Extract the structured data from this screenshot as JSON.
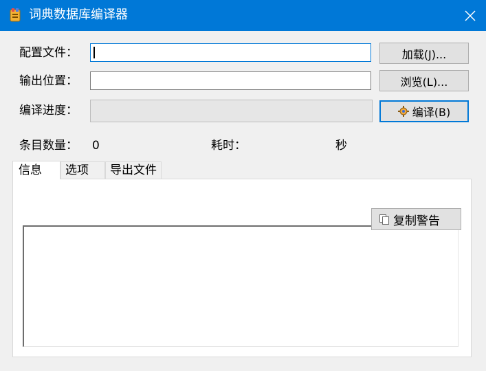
{
  "window": {
    "title": "词典数据库编译器"
  },
  "form": {
    "config_label": "配置文件：",
    "config_value": "",
    "output_label": "输出位置：",
    "output_value": "",
    "progress_label": "编译进度：",
    "progress_value": 0
  },
  "buttons": {
    "load": "加载(J)...",
    "browse": "浏览(L)...",
    "compile": "编译(B)",
    "copy_warnings": "复制警告"
  },
  "stats": {
    "entry_count_label": "条目数量：",
    "entry_count_value": "0",
    "time_label": "耗时：",
    "time_unit": "秒"
  },
  "tabs": [
    {
      "label": "信息",
      "active": true
    },
    {
      "label": "选项",
      "active": false
    },
    {
      "label": "导出文件",
      "active": false
    }
  ],
  "colors": {
    "titlebar": "#0078d7",
    "accent": "#0078d7"
  },
  "icons": {
    "app": "app-icon",
    "close": "close-icon",
    "compile": "compile-icon",
    "copy": "copy-icon"
  }
}
